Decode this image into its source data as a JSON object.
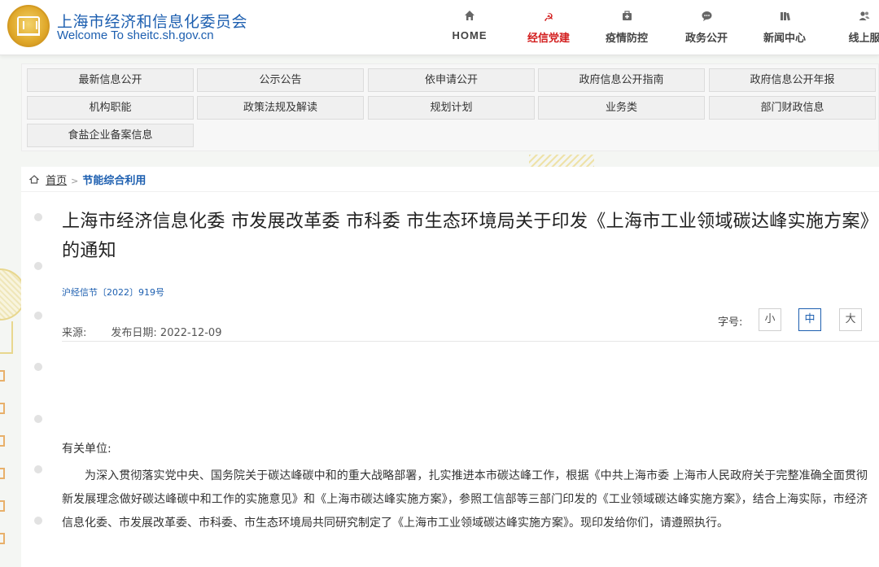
{
  "header": {
    "site_title": "上海市经济和信息化委员会",
    "site_subtitle": "Welcome To sheitc.sh.gov.cn",
    "nav": [
      {
        "label": "HOME",
        "icon": "home-icon",
        "active": false
      },
      {
        "label": "经信党建",
        "icon": "party-emblem-icon",
        "active": true
      },
      {
        "label": "疫情防控",
        "icon": "medkit-icon",
        "active": false
      },
      {
        "label": "政务公开",
        "icon": "chat-icon",
        "active": false
      },
      {
        "label": "新闻中心",
        "icon": "books-icon",
        "active": false
      },
      {
        "label": "线上服",
        "icon": "users-icon",
        "active": false
      }
    ],
    "accent_color": "#d21c1c",
    "brand_color": "#1d5fb0"
  },
  "menu": {
    "items": [
      "最新信息公开",
      "公示公告",
      "依申请公开",
      "政府信息公开指南",
      "政府信息公开年报",
      "机构职能",
      "政策法规及解读",
      "规划计划",
      "业务类",
      "部门财政信息",
      "食盐企业备案信息"
    ]
  },
  "breadcrumb": {
    "home": "首页",
    "separator": ">",
    "current": "节能综合利用"
  },
  "article": {
    "title": "上海市经济信息化委 市发展改革委 市科委 市生态环境局关于印发《上海市工业领域碳达峰实施方案》的通知",
    "doc_number": "沪经信节〔2022〕919号",
    "source_label": "来源:",
    "date_label": "发布日期:",
    "date": "2022-12-09",
    "font_size_label": "字号:",
    "font_sizes": [
      "小",
      "中",
      "大"
    ],
    "selected_font_size": "中",
    "salutation": "有关单位:",
    "body": "为深入贯彻落实党中央、国务院关于碳达峰碳中和的重大战略部署，扎实推进本市碳达峰工作，根据《中共上海市委 上海市人民政府关于完整准确全面贯彻新发展理念做好碳达峰碳中和工作的实施意见》和《上海市碳达峰实施方案》，参照工信部等三部门印发的《工业领域碳达峰实施方案》，结合上海实际，市经济信息化委、市发展改革委、市科委、市生态环境局共同研究制定了《上海市工业领域碳达峰实施方案》。现印发给你们，请遵照执行。"
  }
}
